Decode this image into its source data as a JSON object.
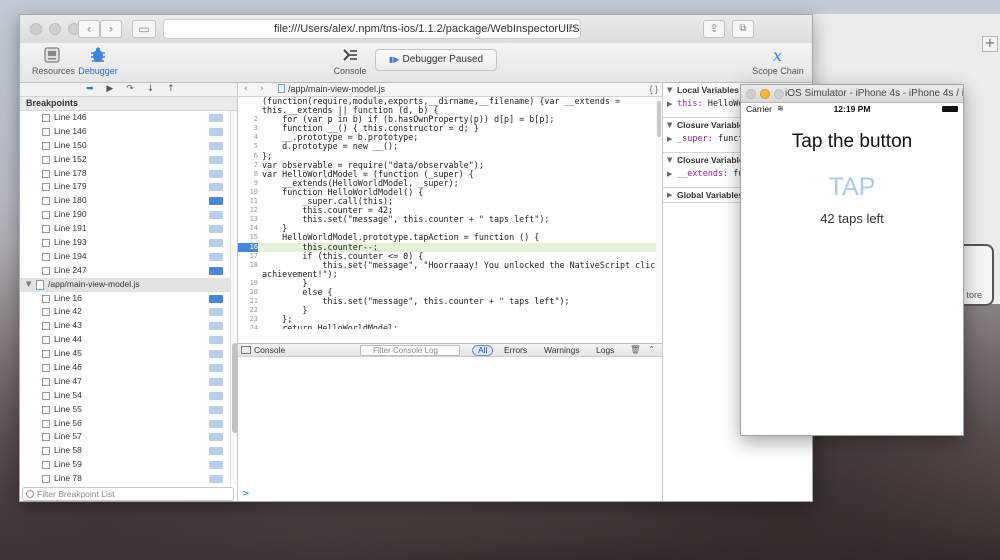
{
  "safari": {
    "url": "file:///Users/alex/.npm/tns-ios/1.1.2/package/WebInspectorUI/Safari/Ma",
    "plus": "+"
  },
  "toolbar": {
    "resources_label": "Resources",
    "debugger_label": "Debugger",
    "console_label": "Console",
    "paused_label": "Debugger Paused",
    "scope_chain_label": "Scope Chain"
  },
  "sidebar": {
    "breakpoints_header": "Breakpoints",
    "filter_placeholder": "Filter Breakpoint List",
    "file_name": "/app/main-view-model.js",
    "rows_top": [
      {
        "label": "Line 146",
        "active": false
      },
      {
        "label": "Line 146",
        "active": false
      },
      {
        "label": "Line 150",
        "active": false
      },
      {
        "label": "Line 152",
        "active": false
      },
      {
        "label": "Line 178",
        "active": false
      },
      {
        "label": "Line 179",
        "active": false
      },
      {
        "label": "Line 180",
        "active": true
      },
      {
        "label": "Line 190",
        "active": false
      },
      {
        "label": "Line 191",
        "active": false
      },
      {
        "label": "Line 193",
        "active": false
      },
      {
        "label": "Line 194",
        "active": false
      },
      {
        "label": "Line 247",
        "active": true
      }
    ],
    "rows_bottom": [
      {
        "label": "Line 16",
        "active": true
      },
      {
        "label": "Line 42",
        "active": false
      },
      {
        "label": "Line 43",
        "active": false
      },
      {
        "label": "Line 44",
        "active": false
      },
      {
        "label": "Line 45",
        "active": false
      },
      {
        "label": "Line 46",
        "active": false
      },
      {
        "label": "Line 47",
        "active": false
      },
      {
        "label": "Line 54",
        "active": false
      },
      {
        "label": "Line 55",
        "active": false
      },
      {
        "label": "Line 56",
        "active": false
      },
      {
        "label": "Line 57",
        "active": false
      },
      {
        "label": "Line 58",
        "active": false
      },
      {
        "label": "Line 59",
        "active": false
      },
      {
        "label": "Line 78",
        "active": false
      },
      {
        "label": "Line 82",
        "active": false
      }
    ]
  },
  "editor": {
    "path": "/app/main-view-model.js",
    "braces": "{ }",
    "lines": [
      {
        "n": "",
        "t": "(function(require,module,exports,__dirname,__filename) {var __extends =",
        "hl": false
      },
      {
        "n": "",
        "t": "this.__extends || function (d, b) {",
        "hl": false
      },
      {
        "n": "2",
        "t": "    for (var p in b) if (b.hasOwnProperty(p)) d[p] = b[p];",
        "hl": false
      },
      {
        "n": "3",
        "t": "    function __() { this.constructor = d; }",
        "hl": false
      },
      {
        "n": "4",
        "t": "    __.prototype = b.prototype;",
        "hl": false
      },
      {
        "n": "5",
        "t": "    d.prototype = new __();",
        "hl": false
      },
      {
        "n": "6",
        "t": "};",
        "hl": false
      },
      {
        "n": "7",
        "t": "var observable = require(\"data/observable\");",
        "hl": false
      },
      {
        "n": "8",
        "t": "var HelloWorldModel = (function (_super) {",
        "hl": false
      },
      {
        "n": "9",
        "t": "    __extends(HelloWorldModel, _super);",
        "hl": false
      },
      {
        "n": "10",
        "t": "    function HelloWorldModel() {",
        "hl": false
      },
      {
        "n": "11",
        "t": "        _super.call(this);",
        "hl": false
      },
      {
        "n": "12",
        "t": "        this.counter = 42;",
        "hl": false
      },
      {
        "n": "13",
        "t": "        this.set(\"message\", this.counter + \" taps left\");",
        "hl": false
      },
      {
        "n": "14",
        "t": "    }",
        "hl": false
      },
      {
        "n": "15",
        "t": "    HelloWorldModel.prototype.tapAction = function () {",
        "hl": false
      },
      {
        "n": "16",
        "t": "        this.counter--;",
        "hl": true
      },
      {
        "n": "17",
        "t": "        if (this.counter <= 0) {",
        "hl": false
      },
      {
        "n": "18",
        "t": "            this.set(\"message\", \"Hoorraaay! You unlocked the NativeScript clicker",
        "hl": false
      },
      {
        "n": "",
        "t": "achievement!\");",
        "hl": false
      },
      {
        "n": "19",
        "t": "        }",
        "hl": false
      },
      {
        "n": "20",
        "t": "        else {",
        "hl": false
      },
      {
        "n": "21",
        "t": "            this.set(\"message\", this.counter + \" taps left\");",
        "hl": false
      },
      {
        "n": "22",
        "t": "        }",
        "hl": false
      },
      {
        "n": "23",
        "t": "    };",
        "hl": false
      },
      {
        "n": "24",
        "t": "    return HelloWorldModel;",
        "hl": false
      },
      {
        "n": "25",
        "t": "})(observable.Observable);",
        "hl": false
      }
    ]
  },
  "console": {
    "label": "Console",
    "filter_placeholder": "Filter Console Log",
    "all": "All",
    "errors": "Errors",
    "warnings": "Warnings",
    "logs": "Logs",
    "prompt": ">"
  },
  "scope": {
    "local_header": "Local Variables",
    "local_item_name": "this:",
    "local_item_value": "HelloWorldM",
    "closure1_header": "Closure Variables",
    "closure1_item_name": "_super:",
    "closure1_item_value": "functio",
    "closure2_header": "Closure Variables",
    "closure2_item_name": "__extends:",
    "closure2_item_value": "func",
    "global_header": "Global Variables"
  },
  "simulator": {
    "title": "iOS Simulator - iPhone 4s - iPhone 4s / iOS 8.1",
    "carrier": "Carrier",
    "time": "12:19 PM",
    "heading": "Tap the button",
    "tap": "TAP",
    "message": "42 taps left"
  },
  "background": {
    "store_label": "tore"
  }
}
